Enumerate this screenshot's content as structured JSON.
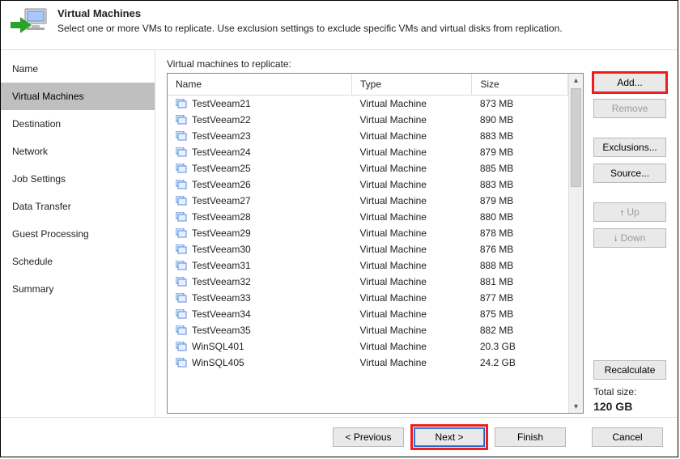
{
  "header": {
    "title": "Virtual Machines",
    "subtitle": "Select one or more VMs to replicate. Use exclusion settings to exclude specific VMs and virtual disks from replication."
  },
  "sidebar": {
    "items": [
      {
        "label": "Name"
      },
      {
        "label": "Virtual Machines"
      },
      {
        "label": "Destination"
      },
      {
        "label": "Network"
      },
      {
        "label": "Job Settings"
      },
      {
        "label": "Data Transfer"
      },
      {
        "label": "Guest Processing"
      },
      {
        "label": "Schedule"
      },
      {
        "label": "Summary"
      }
    ],
    "active_index": 1
  },
  "content": {
    "list_label": "Virtual machines to replicate:",
    "columns": {
      "name": "Name",
      "type": "Type",
      "size": "Size"
    },
    "rows": [
      {
        "name": "TestVeeam21",
        "type": "Virtual Machine",
        "size": "873 MB"
      },
      {
        "name": "TestVeeam22",
        "type": "Virtual Machine",
        "size": "890 MB"
      },
      {
        "name": "TestVeeam23",
        "type": "Virtual Machine",
        "size": "883 MB"
      },
      {
        "name": "TestVeeam24",
        "type": "Virtual Machine",
        "size": "879 MB"
      },
      {
        "name": "TestVeeam25",
        "type": "Virtual Machine",
        "size": "885 MB"
      },
      {
        "name": "TestVeeam26",
        "type": "Virtual Machine",
        "size": "883 MB"
      },
      {
        "name": "TestVeeam27",
        "type": "Virtual Machine",
        "size": "879 MB"
      },
      {
        "name": "TestVeeam28",
        "type": "Virtual Machine",
        "size": "880 MB"
      },
      {
        "name": "TestVeeam29",
        "type": "Virtual Machine",
        "size": "878 MB"
      },
      {
        "name": "TestVeeam30",
        "type": "Virtual Machine",
        "size": "876 MB"
      },
      {
        "name": "TestVeeam31",
        "type": "Virtual Machine",
        "size": "888 MB"
      },
      {
        "name": "TestVeeam32",
        "type": "Virtual Machine",
        "size": "881 MB"
      },
      {
        "name": "TestVeeam33",
        "type": "Virtual Machine",
        "size": "877 MB"
      },
      {
        "name": "TestVeeam34",
        "type": "Virtual Machine",
        "size": "875 MB"
      },
      {
        "name": "TestVeeam35",
        "type": "Virtual Machine",
        "size": "882 MB"
      },
      {
        "name": "WinSQL401",
        "type": "Virtual Machine",
        "size": "20.3 GB"
      },
      {
        "name": "WinSQL405",
        "type": "Virtual Machine",
        "size": "24.2 GB"
      }
    ]
  },
  "side_buttons": {
    "add": "Add...",
    "remove": "Remove",
    "exclusions": "Exclusions...",
    "source": "Source...",
    "up": "Up",
    "down": "Down",
    "recalculate": "Recalculate"
  },
  "totals": {
    "label": "Total size:",
    "value": "120 GB"
  },
  "footer": {
    "previous": "< Previous",
    "next": "Next >",
    "finish": "Finish",
    "cancel": "Cancel"
  }
}
